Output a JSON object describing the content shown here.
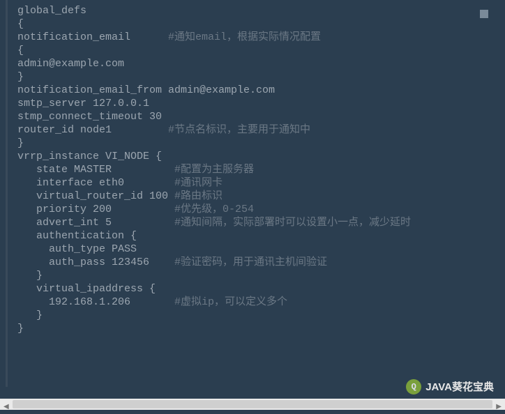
{
  "code": {
    "lines": [
      {
        "c": "global_defs",
        "cm": ""
      },
      {
        "c": "{",
        "cm": ""
      },
      {
        "c": "notification_email      ",
        "cm": "#通知email，根据实际情况配置"
      },
      {
        "c": "{",
        "cm": ""
      },
      {
        "c": "admin@example.com",
        "cm": ""
      },
      {
        "c": "}",
        "cm": ""
      },
      {
        "c": "notification_email_from admin@example.com",
        "cm": ""
      },
      {
        "c": "smtp_server 127.0.0.1",
        "cm": ""
      },
      {
        "c": "stmp_connect_timeout 30",
        "cm": ""
      },
      {
        "c": "router_id node1         ",
        "cm": "#节点名标识，主要用于通知中"
      },
      {
        "c": "}",
        "cm": ""
      },
      {
        "c": "",
        "cm": ""
      },
      {
        "c": "vrrp_instance VI_NODE {",
        "cm": ""
      },
      {
        "c": "   state MASTER          ",
        "cm": "#配置为主服务器"
      },
      {
        "c": "   interface eth0        ",
        "cm": "#通讯网卡"
      },
      {
        "c": "   virtual_router_id 100 ",
        "cm": "#路由标识"
      },
      {
        "c": "   priority 200          ",
        "cm": "#优先级，0-254"
      },
      {
        "c": "   advert_int 5          ",
        "cm": "#通知间隔，实际部署时可以设置小一点，减少延时"
      },
      {
        "c": "",
        "cm": ""
      },
      {
        "c": "   authentication {",
        "cm": ""
      },
      {
        "c": "     auth_type PASS",
        "cm": ""
      },
      {
        "c": "     auth_pass 123456    ",
        "cm": "#验证密码，用于通讯主机间验证"
      },
      {
        "c": "   }",
        "cm": ""
      },
      {
        "c": "",
        "cm": ""
      },
      {
        "c": "   virtual_ipaddress {",
        "cm": ""
      },
      {
        "c": "     192.168.1.206       ",
        "cm": "#虚拟ip，可以定义多个"
      },
      {
        "c": "   }",
        "cm": ""
      },
      {
        "c": "}",
        "cm": ""
      }
    ]
  },
  "watermark": {
    "icon_glyph": "Q",
    "label": "JAVA葵花宝典"
  }
}
